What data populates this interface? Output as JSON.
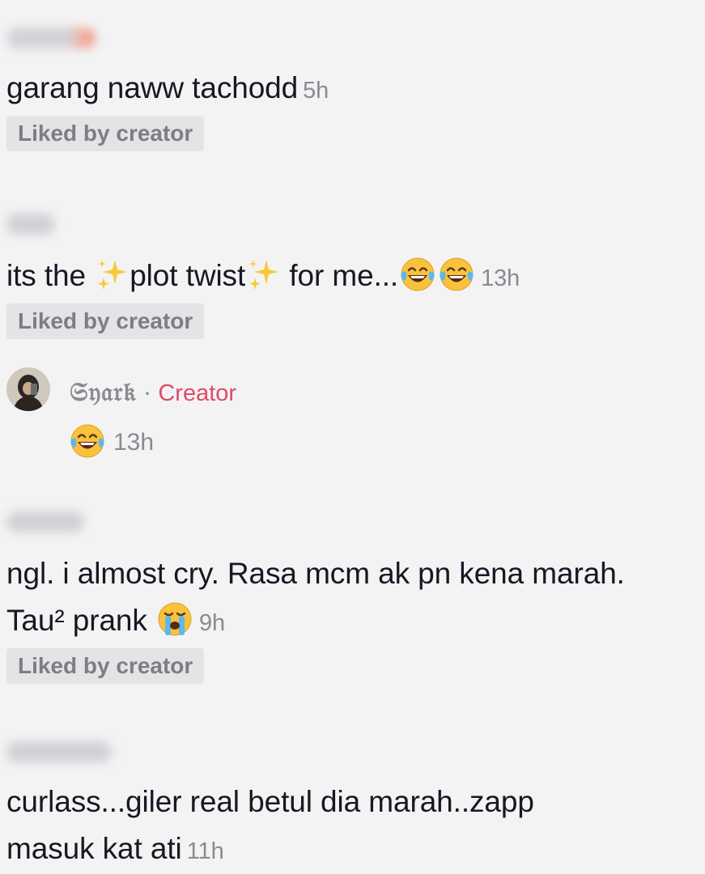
{
  "comments": [
    {
      "text": "garang naww tachodd",
      "time": "5h",
      "liked_badge": "Liked by creator"
    },
    {
      "text_part1": "its the ",
      "text_part2": "plot twist",
      "text_part3": " for me...",
      "time": "13h",
      "liked_badge": "Liked by creator",
      "emojis": [
        "sparkles",
        "face-with-tears-of-joy"
      ]
    },
    {
      "text_line1": "ngl. i almost cry. Rasa mcm ak pn kena marah.",
      "text_line2": "Tau² prank",
      "time": "9h",
      "liked_badge": "Liked by creator",
      "emojis": [
        "loudly-crying-face"
      ]
    },
    {
      "text_line1": "curlass...giler real betul dia marah..zapp",
      "text_line2": "masuk kat ati",
      "time": "11h"
    }
  ],
  "reply": {
    "username": "𝔖𝔶𝔞𝔯𝔨",
    "separator": "·",
    "creator_tag": "Creator",
    "time": "13h",
    "emojis": [
      "face-with-tears-of-joy"
    ]
  },
  "colors": {
    "background": "#f3f3f4",
    "text": "#161823",
    "muted": "#8a8b91",
    "badge_bg": "#e4e4e6",
    "creator": "#e04a67"
  }
}
